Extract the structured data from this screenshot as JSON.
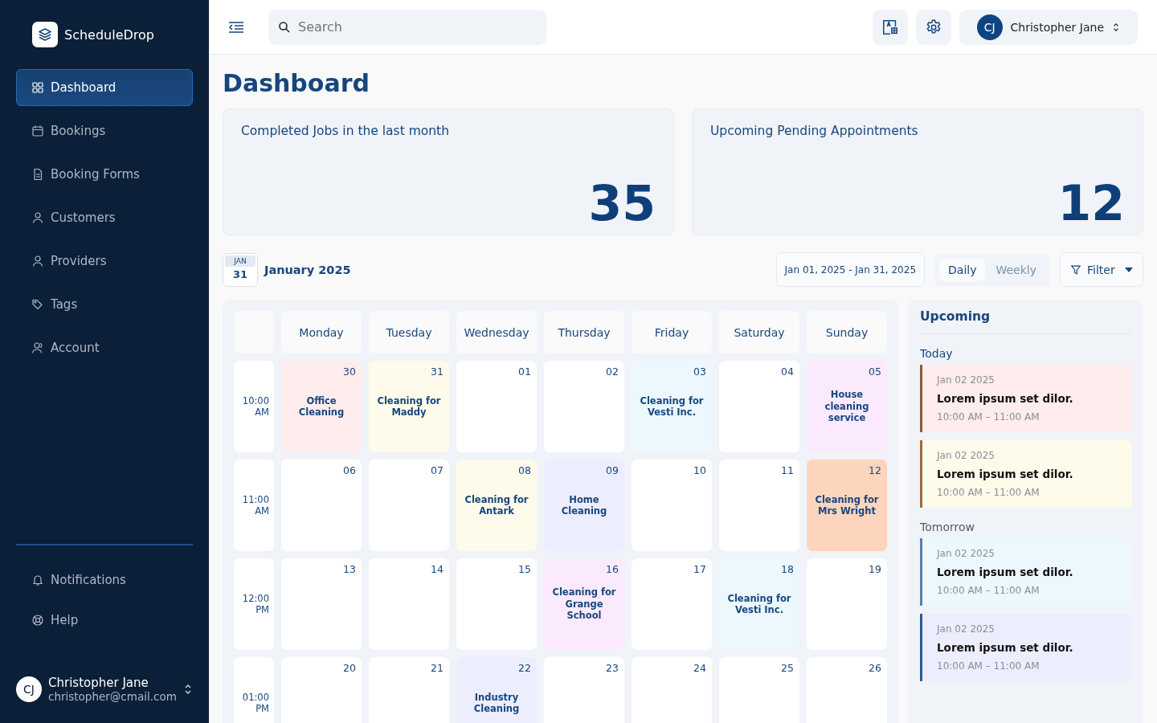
{
  "sidebar": {
    "brand": "ScheduleDrop",
    "items": [
      {
        "label": "Dashboard",
        "selected": true
      },
      {
        "label": "Bookings",
        "selected": false
      },
      {
        "label": "Booking Forms",
        "selected": false
      },
      {
        "label": "Customers",
        "selected": false
      },
      {
        "label": "Providers",
        "selected": false
      },
      {
        "label": "Tags",
        "selected": false
      },
      {
        "label": "Account",
        "selected": false
      }
    ],
    "bottom_items": [
      {
        "label": "Notifications",
        "selected": false
      },
      {
        "label": "Help",
        "selected": false
      }
    ],
    "user": {
      "initials": "CJ",
      "name": "Christopher Jane",
      "email": "christopher@cmail.com"
    }
  },
  "header": {
    "search": {
      "placeholder": "Search"
    },
    "user": {
      "initials": "CJ",
      "name": "Christopher Jane"
    }
  },
  "page_title": "Dashboard",
  "stats": [
    {
      "label": "Completed Jobs in the last month",
      "value": "35"
    },
    {
      "label": "Upcoming Pending Appointments",
      "value": "12"
    }
  ],
  "calendar": {
    "badge_month": "JAN",
    "badge_day": "31",
    "title": "January 2025",
    "date_range": "Jan 01, 2025 - Jan 31, 2025",
    "views": [
      {
        "label": "Daily",
        "selected": true
      },
      {
        "label": "Weekly",
        "selected": false
      }
    ],
    "filter": "Filter",
    "days": [
      "Monday",
      "Tuesday",
      "Wednesday",
      "Thursday",
      "Friday",
      "Saturday",
      "Sunday"
    ],
    "rows": [
      {
        "time": "10:00 AM",
        "cells": [
          {
            "date": "30",
            "event": "Office Cleaning",
            "color": "#ffecec"
          },
          {
            "date": "31",
            "event": "Cleaning for Maddy",
            "color": "#fefbea"
          },
          {
            "date": "01",
            "color": "#ffffff"
          },
          {
            "date": "02",
            "color": "#ffffff"
          },
          {
            "date": "03",
            "event": "Cleaning for Vesti Inc.",
            "color": "#ecf8fe"
          },
          {
            "date": "04",
            "color": "#ffffff"
          },
          {
            "date": "05",
            "event": "House cleaning service",
            "color": "#fbeafd"
          }
        ]
      },
      {
        "time": "11:00 AM",
        "cells": [
          {
            "date": "06",
            "color": "#ffffff"
          },
          {
            "date": "07",
            "color": "#ffffff"
          },
          {
            "date": "08",
            "event": "Cleaning for Antark",
            "color": "#fefbea"
          },
          {
            "date": "09",
            "event": "Home Cleaning",
            "color": "#ecedfd"
          },
          {
            "date": "10",
            "color": "#ffffff"
          },
          {
            "date": "11",
            "color": "#ffffff"
          },
          {
            "date": "12",
            "event": "Cleaning for Mrs Wright",
            "color": "#fdd5bd"
          }
        ]
      },
      {
        "time": "12:00 PM",
        "cells": [
          {
            "date": "13",
            "color": "#ffffff"
          },
          {
            "date": "14",
            "color": "#ffffff"
          },
          {
            "date": "15",
            "color": "#ffffff"
          },
          {
            "date": "16",
            "event": "Cleaning for Grange School",
            "color": "#fbeafd"
          },
          {
            "date": "17",
            "color": "#ffffff"
          },
          {
            "date": "18",
            "event": "Cleaning for Vesti Inc.",
            "color": "#ecf8fe"
          },
          {
            "date": "19",
            "color": "#ffffff"
          }
        ]
      },
      {
        "time": "01:00 PM",
        "cells": [
          {
            "date": "20",
            "color": "#ffffff"
          },
          {
            "date": "21",
            "color": "#ffffff"
          },
          {
            "date": "22",
            "event": "Industry Cleaning",
            "color": "#ecedfd"
          },
          {
            "date": "23",
            "color": "#ffffff"
          },
          {
            "date": "24",
            "color": "#ffffff"
          },
          {
            "date": "25",
            "color": "#ffffff"
          },
          {
            "date": "26",
            "color": "#ffffff"
          }
        ]
      }
    ]
  },
  "upcoming": {
    "title": "Upcoming",
    "groups": [
      {
        "label": "Today",
        "items": [
          {
            "date": "Jan 02 2025",
            "title": "Lorem ipsum set dilor.",
            "time": "10:00 AM – 11:00 AM",
            "color": "#ffecec"
          },
          {
            "date": "Jan 02 2025",
            "title": "Lorem ipsum set dilor.",
            "time": "10:00 AM – 11:00 AM",
            "color": "#fefbea"
          }
        ]
      },
      {
        "label": "Tomorrow",
        "items": [
          {
            "date": "Jan 02 2025",
            "title": "Lorem ipsum set dilor.",
            "time": "10:00 AM – 11:00 AM",
            "color": "#ecf8fe"
          },
          {
            "date": "Jan 02 2025",
            "title": "Lorem ipsum set dilor.",
            "time": "10:00 AM – 11:00 AM",
            "color": "#ecedfd"
          }
        ]
      }
    ]
  }
}
